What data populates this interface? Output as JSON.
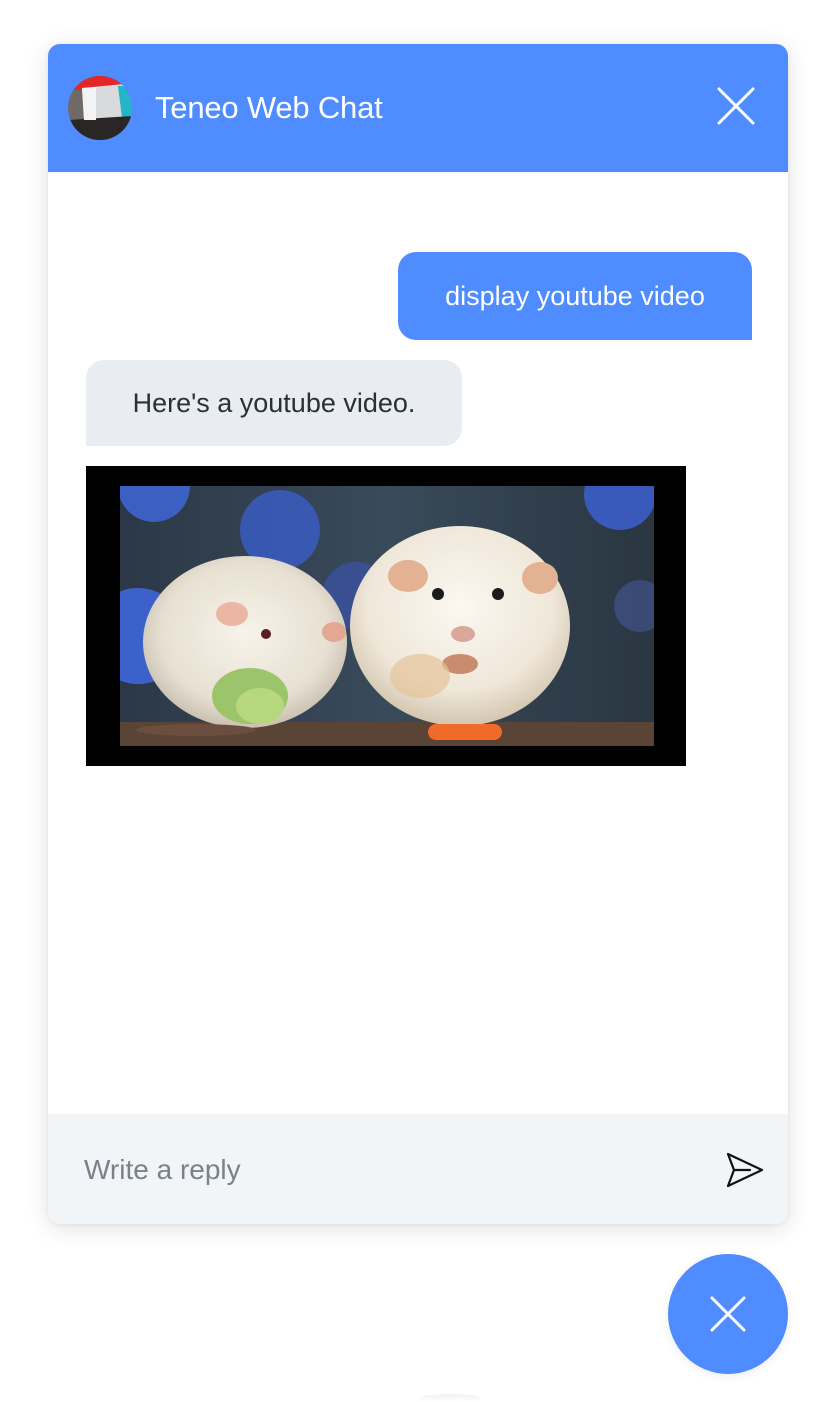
{
  "colors": {
    "accent": "#4f8cff",
    "bot_bubble": "#e9edf1",
    "input_bar": "#f2f5f8",
    "text_dark": "#283039",
    "placeholder": "#7b8189"
  },
  "header": {
    "title": "Teneo Web Chat",
    "avatar_icon": "bot-avatar-icon",
    "close_icon": "close-icon"
  },
  "messages": [
    {
      "sender": "user",
      "text": "display youtube video"
    },
    {
      "sender": "bot",
      "text": "Here's a youtube video."
    },
    {
      "sender": "bot",
      "type": "video",
      "content": "two white guinea pigs eating vegetables"
    }
  ],
  "input": {
    "value": "",
    "placeholder": "Write a reply",
    "send_icon": "send-icon"
  },
  "launcher": {
    "icon": "close-icon"
  }
}
